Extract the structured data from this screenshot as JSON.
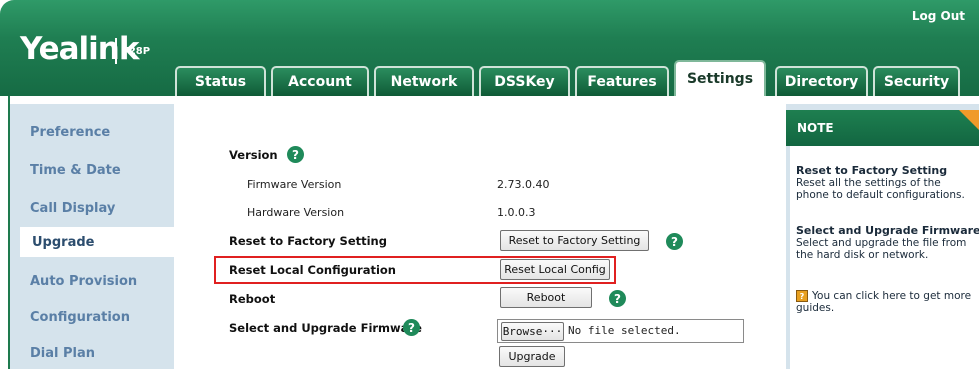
{
  "header": {
    "logo": "Yealink",
    "model": "T28P",
    "logout": "Log Out",
    "tabs": [
      "Status",
      "Account",
      "Network",
      "DSSKey",
      "Features",
      "Settings",
      "Directory",
      "Security"
    ],
    "active_tab": "Settings"
  },
  "sidebar": {
    "items": [
      "Preference",
      "Time & Date",
      "Call Display",
      "Upgrade",
      "Auto Provision",
      "Configuration",
      "Dial Plan"
    ],
    "active_item": "Upgrade"
  },
  "main": {
    "version_label": "Version",
    "firmware_label": "Firmware Version",
    "firmware_value": "2.73.0.40",
    "hardware_label": "Hardware Version",
    "hardware_value": "1.0.0.3",
    "reset_factory_label": "Reset to Factory Setting",
    "reset_factory_button": "Reset to Factory Setting",
    "reset_local_label": "Reset Local Configuration",
    "reset_local_button": "Reset Local Config",
    "reboot_label": "Reboot",
    "reboot_button": "Reboot",
    "upgrade_fw_label": "Select and Upgrade Firmware",
    "browse_button": "Browse···",
    "file_status": "No file selected.",
    "upgrade_button": "Upgrade",
    "help_glyph": "?"
  },
  "note": {
    "title": "NOTE",
    "sections": [
      {
        "heading": "Reset to Factory Setting",
        "text": "Reset all the settings of the phone to default configurations."
      },
      {
        "heading": "Select and Upgrade Firmware",
        "text": "Select and upgrade the file from the hard disk or network."
      }
    ],
    "guide_text": "You can click here to get more guides."
  },
  "colors": {
    "header_green": "#1f7e52",
    "sidebar_bg": "#d5e3ec",
    "sidebar_text": "#5a7fa6",
    "help_icon": "#1f8a5a",
    "highlight_red": "#e02020",
    "note_corner": "#f09a2a"
  }
}
